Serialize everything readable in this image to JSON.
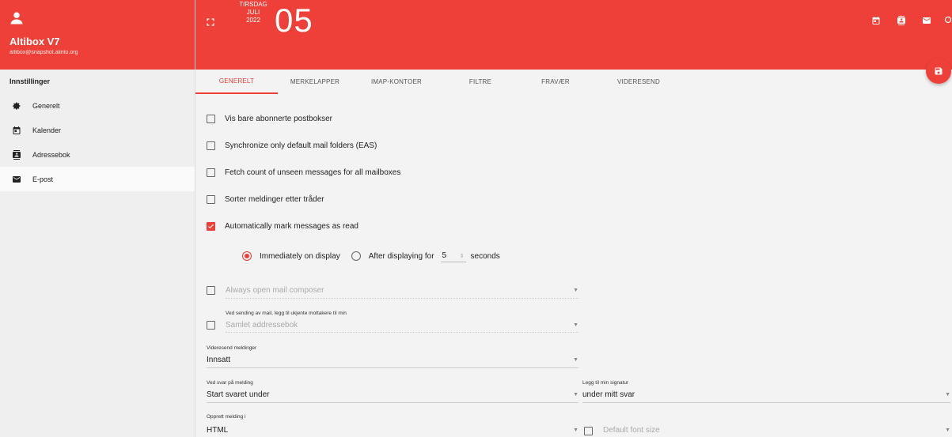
{
  "app": {
    "name": "Altibox V7",
    "email": "altibox@snapshot.alinto.org"
  },
  "sidebar": {
    "section_title": "Innstillinger",
    "items": [
      {
        "label": "Generelt",
        "icon": "gear-icon"
      },
      {
        "label": "Kalender",
        "icon": "calendar-icon"
      },
      {
        "label": "Adressebok",
        "icon": "contacts-icon"
      },
      {
        "label": "E-post",
        "icon": "mail-icon"
      }
    ]
  },
  "header": {
    "day_name": "TIRSDAG",
    "month": "JULI",
    "year": "2022",
    "day_number": "05"
  },
  "tabs": [
    {
      "label": "Generelt",
      "active": true
    },
    {
      "label": "Merkelapper"
    },
    {
      "label": "IMAP-kontoer"
    },
    {
      "label": "Filtre"
    },
    {
      "label": "Fravær"
    },
    {
      "label": "Videresend"
    }
  ],
  "options": {
    "subscribed_only": {
      "label": "Vis bare abonnerte postbokser",
      "checked": false
    },
    "sync_default_folders": {
      "label": "Synchronize only default mail folders (EAS)",
      "checked": false
    },
    "fetch_unseen_count": {
      "label": "Fetch count of unseen messages for all mailboxes",
      "checked": false
    },
    "sort_threads": {
      "label": "Sorter meldinger etter tråder",
      "checked": false
    },
    "auto_mark_read": {
      "label": "Automatically mark messages as read",
      "checked": true
    }
  },
  "mark_read": {
    "immediately_label": "Immediately on display",
    "after_label": "After displaying for",
    "seconds_value": "5",
    "seconds_label": "seconds"
  },
  "composer": {
    "always_open_label": "Always open mail composer",
    "addressbook_field_label": "Ved sending av mail, legg til ukjente mottakere til min",
    "addressbook_value": "Samlet addressebok"
  },
  "forward": {
    "label": "Videresend meldinger",
    "value": "Innsatt"
  },
  "reply": {
    "label": "Ved svar på melding",
    "value": "Start svaret under",
    "signature_label": "Legg til min signatur",
    "signature_value": "under mitt svar"
  },
  "compose_format": {
    "label": "Opprett melding i",
    "value": "HTML",
    "font_size_label": "Default font size"
  },
  "colors": {
    "accent": "#ee4038",
    "sidebar_bg": "#efefef",
    "content_bg": "#f3f3f3"
  }
}
